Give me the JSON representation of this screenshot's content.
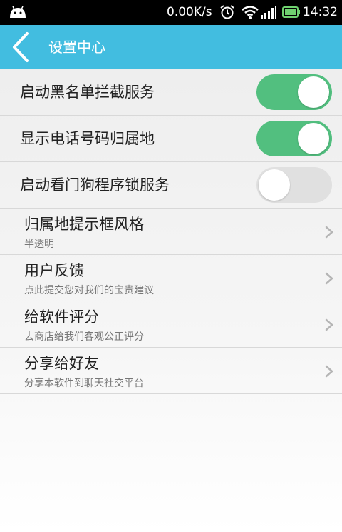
{
  "statusbar": {
    "net_speed": "0.00K/s",
    "time": "14:32",
    "icons": [
      "android-icon",
      "alarm-icon",
      "wifi-icon",
      "signal-icon",
      "battery-icon"
    ]
  },
  "titlebar": {
    "title": "设置中心",
    "background": "#42bde0"
  },
  "settings": [
    {
      "label": "启动黑名单拦截服务",
      "enabled": true
    },
    {
      "label": "显示电话号码归属地",
      "enabled": true
    },
    {
      "label": "启动看门狗程序锁服务",
      "enabled": false
    }
  ],
  "menu": [
    {
      "title": "归属地提示框风格",
      "subtitle": "半透明"
    },
    {
      "title": "用户反馈",
      "subtitle": "点此提交您对我们的宝贵建议"
    },
    {
      "title": "给软件评分",
      "subtitle": "去商店给我们客观公正评分"
    },
    {
      "title": "分享给好友",
      "subtitle": "分享本软件到聊天社交平台"
    }
  ],
  "colors": {
    "toggle_on": "#52bf7f",
    "toggle_off": "#e0e0e0"
  }
}
